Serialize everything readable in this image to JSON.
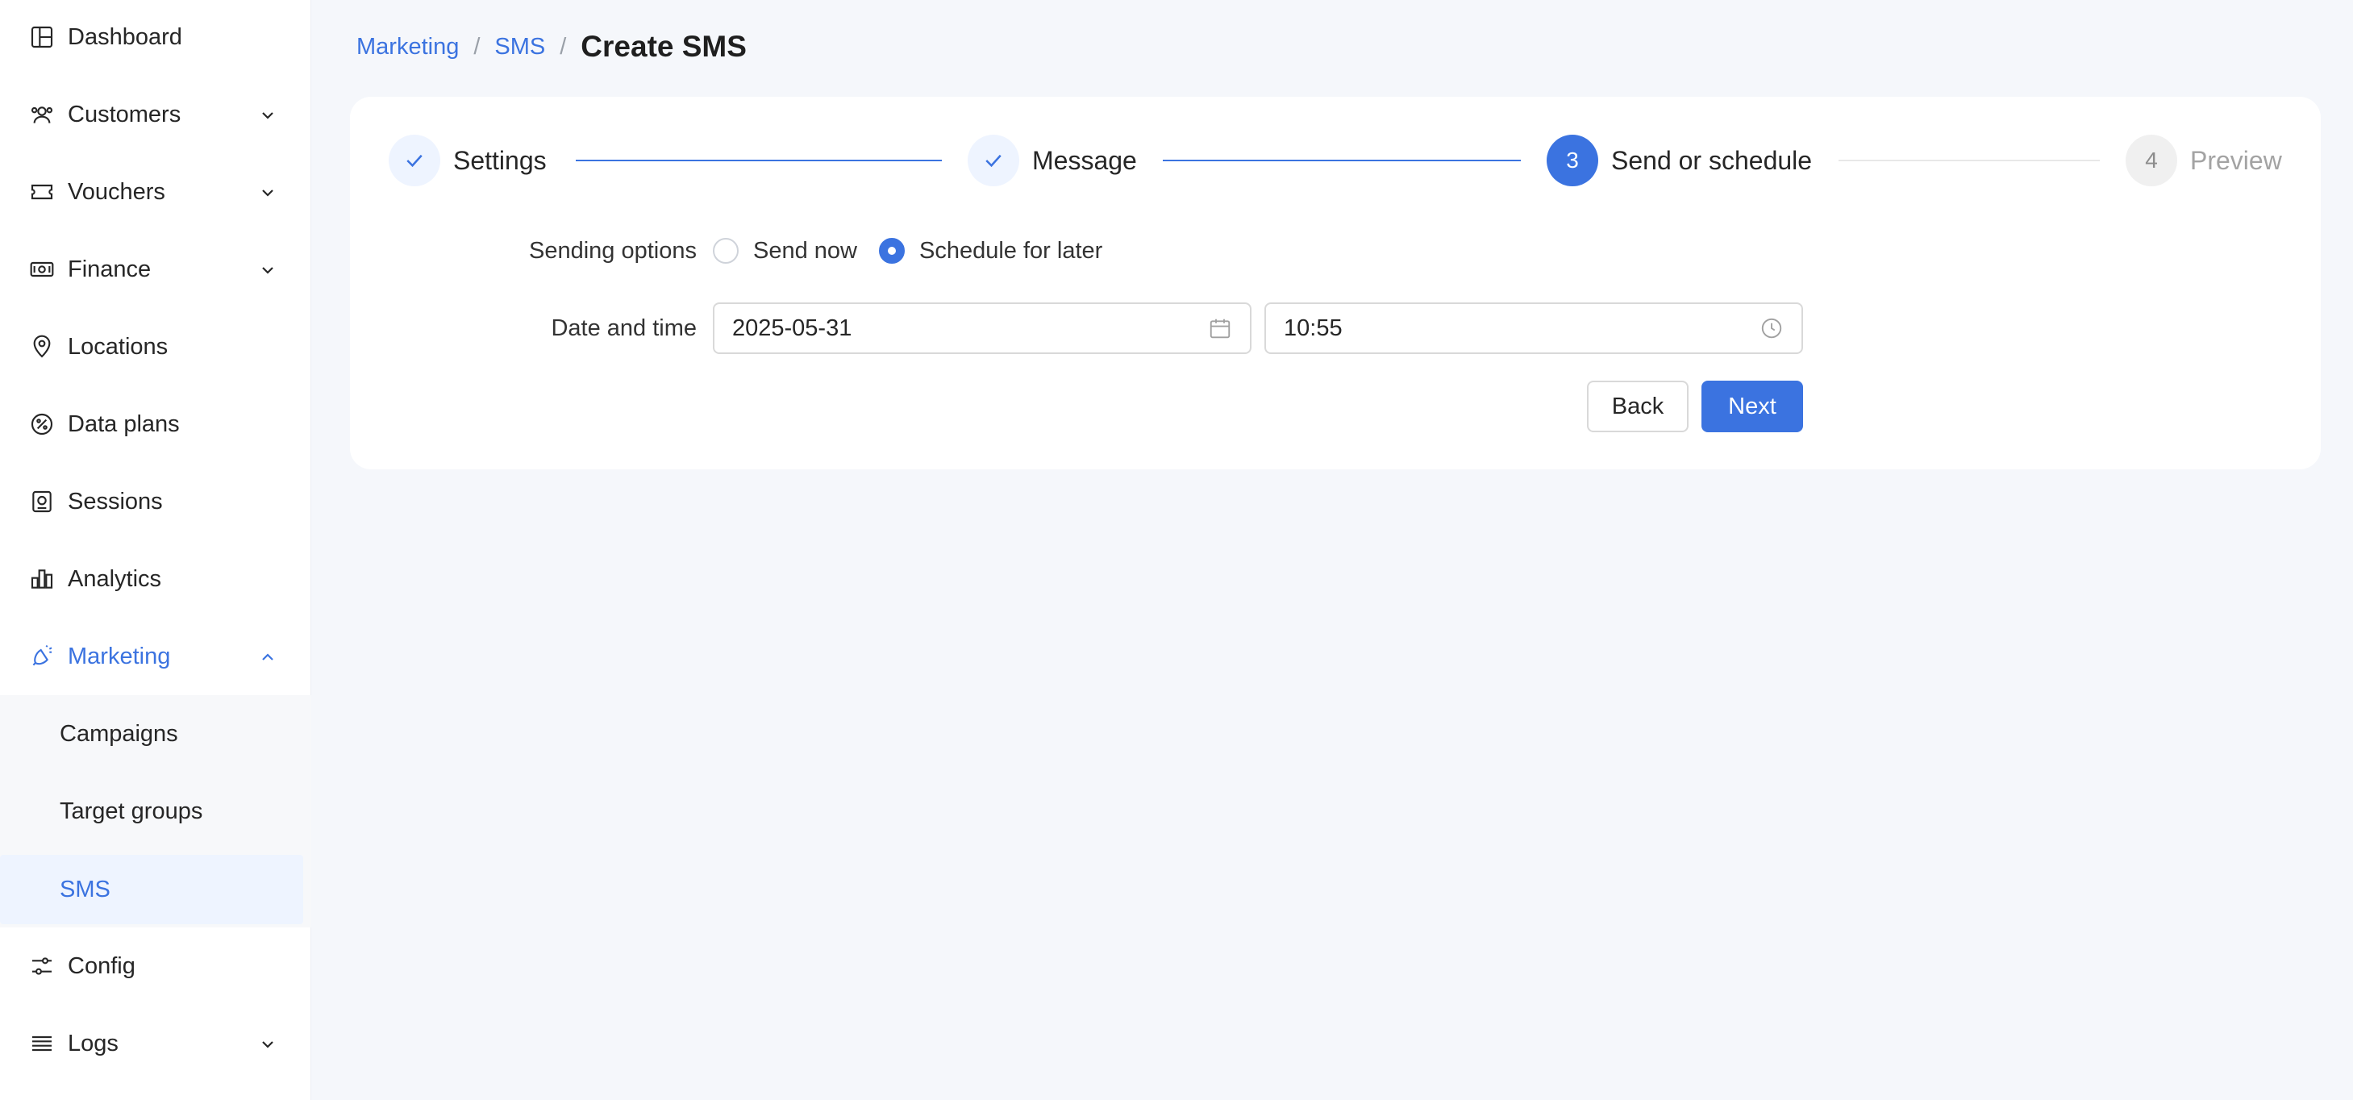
{
  "sidebar": {
    "items": [
      {
        "label": "Dashboard",
        "icon": "dashboard-icon"
      },
      {
        "label": "Customers",
        "icon": "customers-icon"
      },
      {
        "label": "Vouchers",
        "icon": "voucher-icon"
      },
      {
        "label": "Finance",
        "icon": "finance-icon"
      },
      {
        "label": "Locations",
        "icon": "location-pin-icon"
      },
      {
        "label": "Data plans",
        "icon": "data-plans-icon"
      },
      {
        "label": "Sessions",
        "icon": "sessions-icon"
      },
      {
        "label": "Analytics",
        "icon": "analytics-icon"
      },
      {
        "label": "Marketing",
        "icon": "marketing-icon"
      },
      {
        "label": "Config",
        "icon": "config-sliders-icon"
      },
      {
        "label": "Logs",
        "icon": "logs-icon"
      }
    ],
    "marketing_submenu": [
      {
        "label": "Campaigns"
      },
      {
        "label": "Target groups"
      },
      {
        "label": "SMS"
      }
    ]
  },
  "breadcrumb": {
    "items": [
      "Marketing",
      "SMS"
    ],
    "separator": "/",
    "current": "Create SMS"
  },
  "steps": [
    {
      "number": "1",
      "label": "Settings",
      "status": "done"
    },
    {
      "number": "2",
      "label": "Message",
      "status": "done"
    },
    {
      "number": "3",
      "label": "Send or schedule",
      "status": "current"
    },
    {
      "number": "4",
      "label": "Preview",
      "status": "pending"
    }
  ],
  "form": {
    "sending_options_label": "Sending options",
    "options": [
      {
        "label": "Send now",
        "checked": false
      },
      {
        "label": "Schedule for later",
        "checked": true
      }
    ],
    "datetime_label": "Date and time",
    "date_value": "2025-05-31",
    "time_value": "10:55"
  },
  "buttons": {
    "back": "Back",
    "next": "Next"
  },
  "colors": {
    "accent": "#3b73e0",
    "background": "#f5f7fb"
  }
}
